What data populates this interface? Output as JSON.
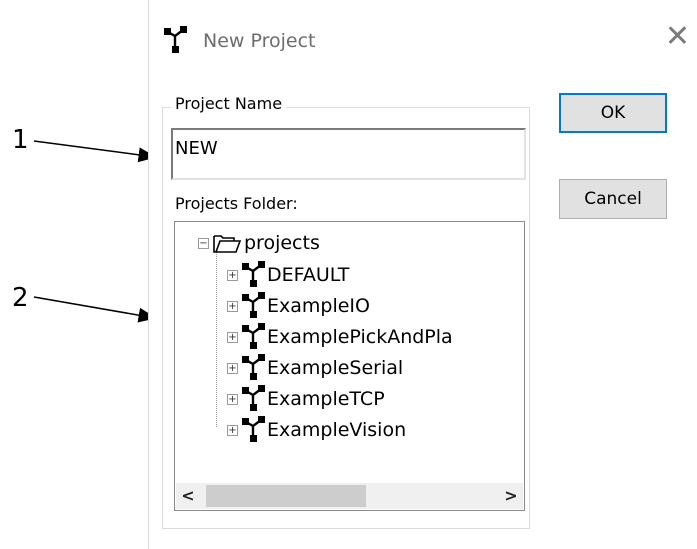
{
  "dialog": {
    "title": "New Project",
    "close_glyph": "✕",
    "group_label": "Project Name",
    "project_name_value": "NEW",
    "folder_label": "Projects Folder:",
    "ok_label": "OK",
    "cancel_label": "Cancel"
  },
  "tree": {
    "root": "projects",
    "items": [
      "DEFAULT",
      "ExampleIO",
      "ExamplePickAndPla",
      "ExampleSerial",
      "ExampleTCP",
      "ExampleVision"
    ],
    "scroll_left": "<",
    "scroll_right": ">"
  },
  "callouts": [
    "1",
    "2"
  ],
  "icons": {
    "title": "project-network-icon",
    "folder": "folder-open-icon",
    "item": "project-network-icon"
  }
}
